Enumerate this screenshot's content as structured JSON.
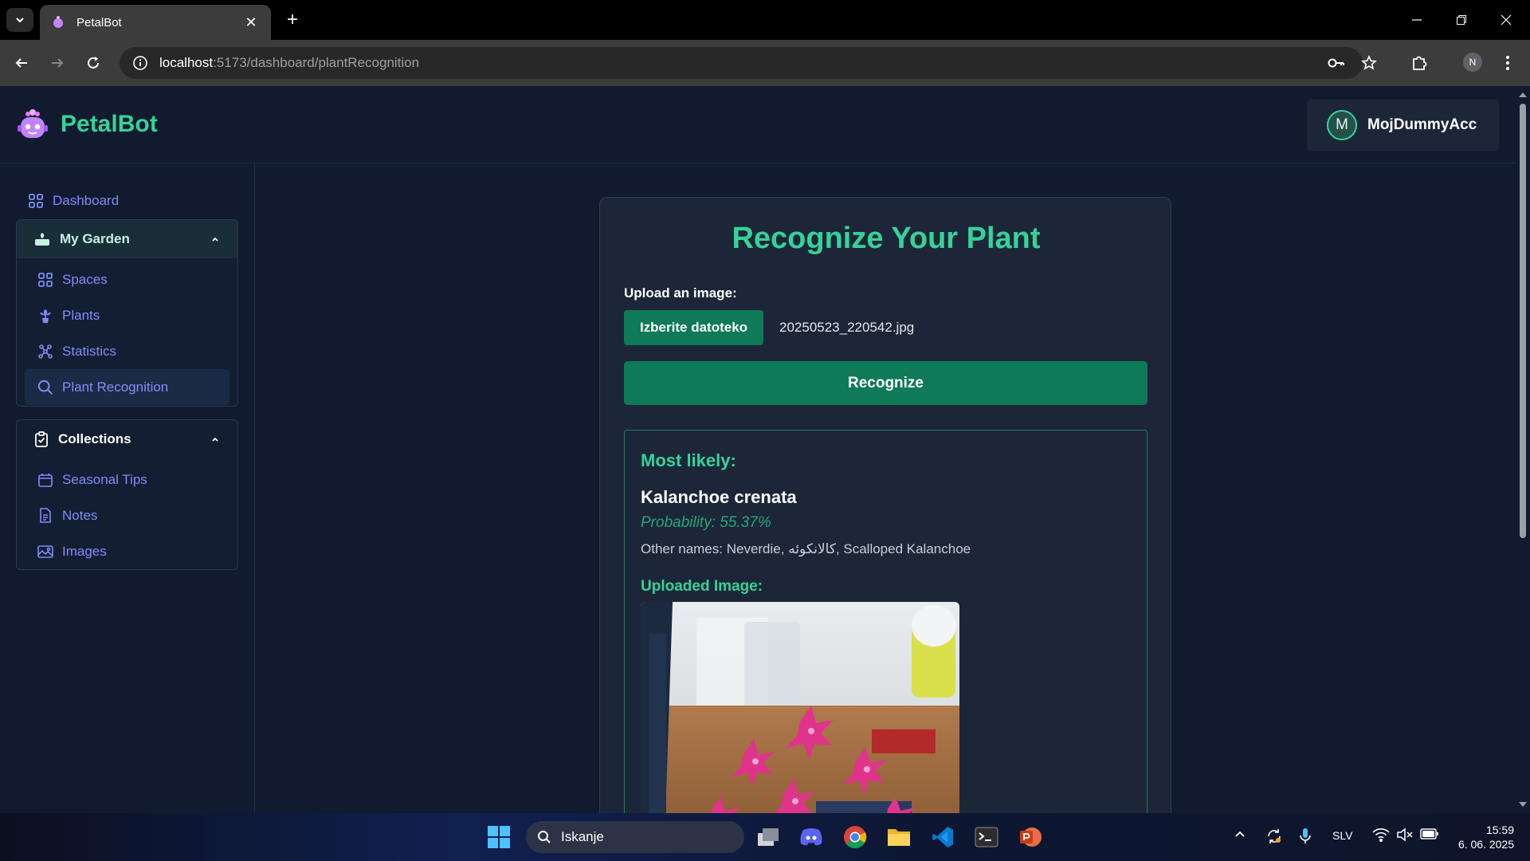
{
  "browser": {
    "tab_title": "PetalBot",
    "url_host": "localhost",
    "url_path": ":5173/dashboard/plantRecognition",
    "profile_initial": "N"
  },
  "header": {
    "app_name": "PetalBot",
    "user_initial": "M",
    "user_name": "MojDummyAcc"
  },
  "sidebar": {
    "dashboard": "Dashboard",
    "my_garden": {
      "title": "My Garden",
      "items": [
        {
          "label": "Spaces",
          "icon": "grid-icon"
        },
        {
          "label": "Plants",
          "icon": "plant-icon"
        },
        {
          "label": "Statistics",
          "icon": "chart-icon"
        },
        {
          "label": "Plant Recognition",
          "icon": "search-icon",
          "active": true
        }
      ]
    },
    "collections": {
      "title": "Collections",
      "items": [
        {
          "label": "Seasonal Tips",
          "icon": "calendar-icon"
        },
        {
          "label": "Notes",
          "icon": "document-icon"
        },
        {
          "label": "Images",
          "icon": "image-icon"
        }
      ]
    }
  },
  "main": {
    "title": "Recognize Your Plant",
    "upload_label": "Upload an image:",
    "file_button": "Izberite datoteko",
    "file_name": "20250523_220542.jpg",
    "recognize_button": "Recognize",
    "result": {
      "heading": "Most likely:",
      "plant_name": "Kalanchoe crenata",
      "probability": "Probability: 55.37%",
      "other_names": "Other names: Neverdie, کالانکوئه, Scalloped Kalanchoe",
      "uploaded_label": "Uploaded Image:"
    }
  },
  "taskbar": {
    "search_placeholder": "Iskanje",
    "language": "SLV",
    "time": "15:59",
    "date": "6. 06. 2025"
  },
  "colors": {
    "accent_green": "#34d399",
    "button_green": "#0f7a57",
    "nav_indigo": "#818cf8",
    "background": "#111a2e",
    "card": "#1c2638"
  }
}
